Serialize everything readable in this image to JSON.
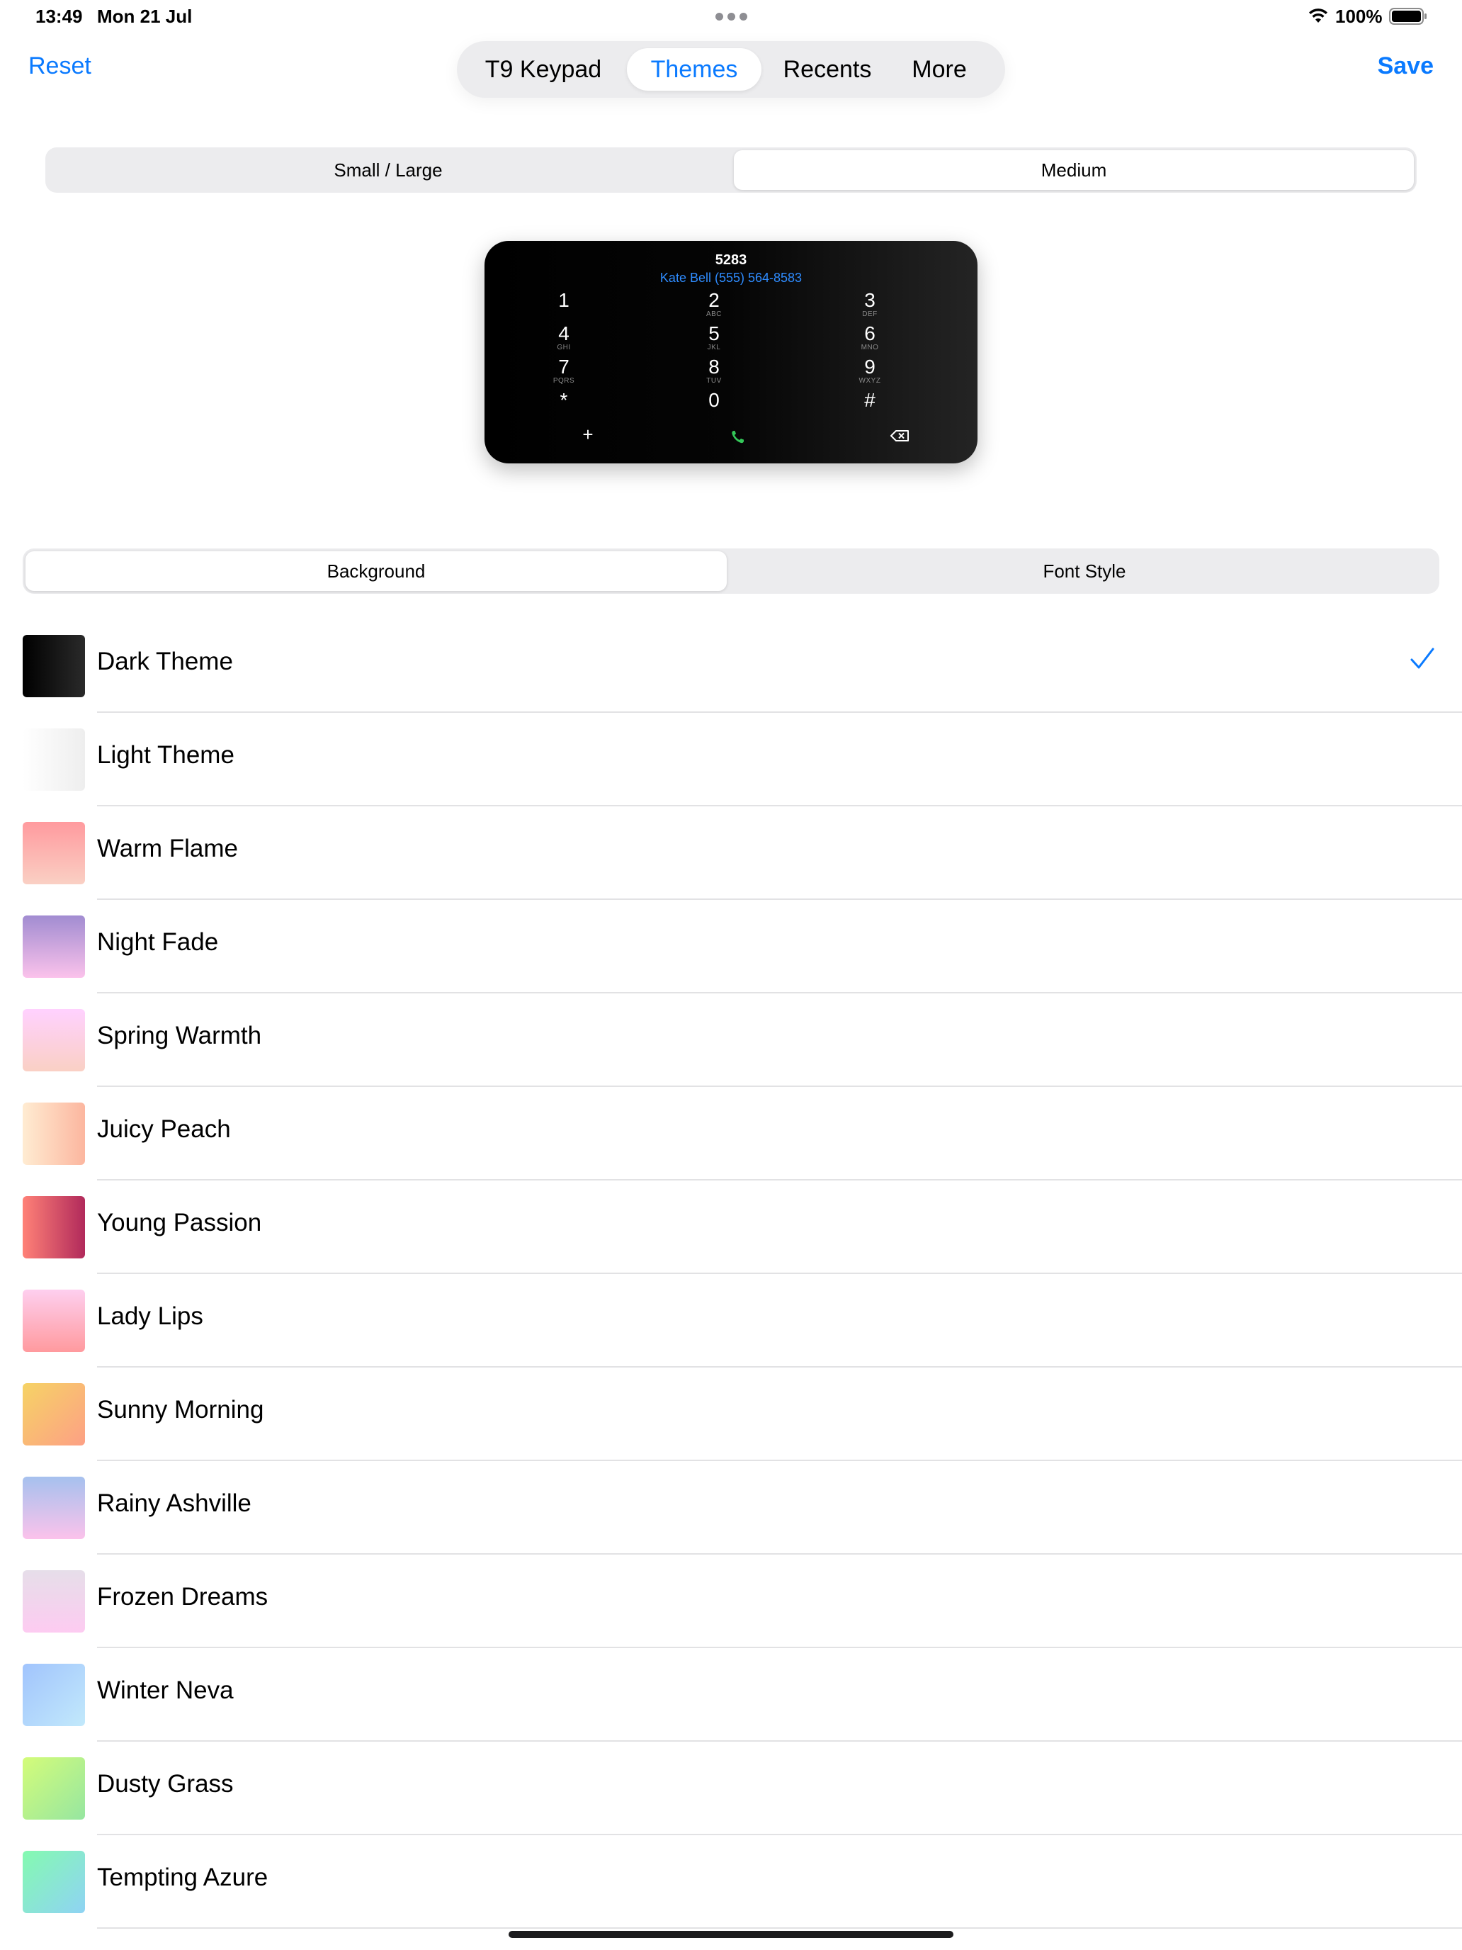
{
  "status": {
    "time": "13:49",
    "date": "Mon 21 Jul",
    "battery": "100%"
  },
  "nav": {
    "reset_label": "Reset",
    "save_label": "Save",
    "tabs": [
      {
        "label": "T9 Keypad"
      },
      {
        "label": "Themes",
        "active": true
      },
      {
        "label": "Recents"
      },
      {
        "label": "More"
      }
    ]
  },
  "size_segment": {
    "items": [
      "Small / Large",
      "Medium"
    ],
    "selected": "Medium"
  },
  "preview": {
    "number": "5283",
    "contact": "Kate Bell (555) 564-8583",
    "keys": [
      {
        "digit": "1",
        "letters": ""
      },
      {
        "digit": "2",
        "letters": "ABC"
      },
      {
        "digit": "3",
        "letters": "DEF"
      },
      {
        "digit": "4",
        "letters": "GHI"
      },
      {
        "digit": "5",
        "letters": "JKL"
      },
      {
        "digit": "6",
        "letters": "MNO"
      },
      {
        "digit": "7",
        "letters": "PQRS"
      },
      {
        "digit": "8",
        "letters": "TUV"
      },
      {
        "digit": "9",
        "letters": "WXYZ"
      },
      {
        "digit": "*",
        "letters": ""
      },
      {
        "digit": "0",
        "letters": ""
      },
      {
        "digit": "#",
        "letters": ""
      }
    ],
    "plus": "+",
    "call_color": "#34c759"
  },
  "style_segment": {
    "items": [
      "Background",
      "Font Style"
    ],
    "selected": "Background"
  },
  "themes": [
    {
      "name": "Dark Theme",
      "from": "#000000",
      "to": "#2a2a2a",
      "dir": "90deg",
      "selected": true
    },
    {
      "name": "Light Theme",
      "from": "#ffffff",
      "to": "#eeeeee",
      "dir": "90deg"
    },
    {
      "name": "Warm Flame",
      "from": "#ff9a9e",
      "to": "#fad0c4",
      "dir": "180deg"
    },
    {
      "name": "Night Fade",
      "from": "#fbc2eb",
      "to": "#a18cd1",
      "dir": "0deg"
    },
    {
      "name": "Spring Warmth",
      "from": "#fad0c4",
      "to": "#ffd1ff",
      "dir": "0deg"
    },
    {
      "name": "Juicy Peach",
      "from": "#ffecd2",
      "to": "#fcb69f",
      "dir": "90deg"
    },
    {
      "name": "Young Passion",
      "from": "#ff8177",
      "to": "#b12a5b",
      "dir": "90deg"
    },
    {
      "name": "Lady Lips",
      "from": "#ff9a9e",
      "to": "#fecfef",
      "dir": "0deg"
    },
    {
      "name": "Sunny Morning",
      "from": "#f6d365",
      "to": "#fda085",
      "dir": "135deg"
    },
    {
      "name": "Rainy Ashville",
      "from": "#fbc2eb",
      "to": "#a6c1ee",
      "dir": "0deg"
    },
    {
      "name": "Frozen Dreams",
      "from": "#fdcbf1",
      "to": "#e6dee9",
      "dir": "0deg"
    },
    {
      "name": "Winter Neva",
      "from": "#a1c4fd",
      "to": "#c2e9fb",
      "dir": "135deg"
    },
    {
      "name": "Dusty Grass",
      "from": "#d4fc79",
      "to": "#96e6a1",
      "dir": "135deg"
    },
    {
      "name": "Tempting Azure",
      "from": "#84fab0",
      "to": "#8fd3f4",
      "dir": "135deg"
    }
  ],
  "colors": {
    "accent": "#0a7aff",
    "separator": "#e2e2e4"
  }
}
